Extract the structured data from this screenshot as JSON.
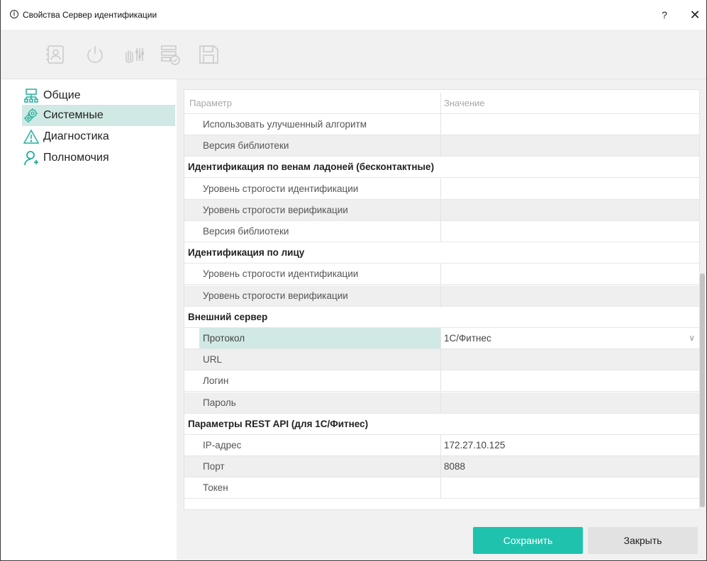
{
  "window": {
    "title": "Свойства Сервер идентификации",
    "help_label": "?",
    "close_label": "✕"
  },
  "toolbar": {
    "icons": [
      "contact-card-icon",
      "power-icon",
      "hand-settings-icon",
      "list-check-icon",
      "save-icon"
    ]
  },
  "sidebar": {
    "items": [
      {
        "label": "Общие",
        "icon": "network-icon",
        "active": false
      },
      {
        "label": "Системные",
        "icon": "gears-icon",
        "active": true
      },
      {
        "label": "Диагностика",
        "icon": "warning-icon",
        "active": false
      },
      {
        "label": "Полномочия",
        "icon": "user-plus-icon",
        "active": false
      }
    ]
  },
  "grid": {
    "header": {
      "param": "Параметр",
      "value": "Значение"
    },
    "rows": [
      {
        "kind": "item",
        "param": "Использовать улучшенный алгоритм",
        "value": ""
      },
      {
        "kind": "item",
        "param": "Версия библиотеки",
        "value": ""
      },
      {
        "kind": "group",
        "param": "Идентификация по венам ладоней (бесконтактные)"
      },
      {
        "kind": "item",
        "param": "Уровень строгости идентификации",
        "value": ""
      },
      {
        "kind": "item",
        "param": "Уровень строгости верификации",
        "value": ""
      },
      {
        "kind": "item",
        "param": "Версия библиотеки",
        "value": ""
      },
      {
        "kind": "group",
        "param": "Идентификация по лицу"
      },
      {
        "kind": "item",
        "param": "Уровень строгости идентификации",
        "value": ""
      },
      {
        "kind": "item",
        "param": "Уровень строгости верификации",
        "value": ""
      },
      {
        "kind": "group",
        "param": "Внешний сервер"
      },
      {
        "kind": "selected",
        "param": "Протокол",
        "value": "1С/Фитнес"
      },
      {
        "kind": "item",
        "param": "URL",
        "value": ""
      },
      {
        "kind": "item",
        "param": "Логин",
        "value": ""
      },
      {
        "kind": "item",
        "param": "Пароль",
        "value": ""
      },
      {
        "kind": "group",
        "param": "Параметры REST API (для 1С/Фитнес)"
      },
      {
        "kind": "item",
        "param": "IP-адрес",
        "value": "172.27.10.125"
      },
      {
        "kind": "item",
        "param": "Порт",
        "value": "8088"
      },
      {
        "kind": "item",
        "param": "Токен",
        "value": ""
      }
    ]
  },
  "footer": {
    "save_label": "Сохранить",
    "close_label": "Закрыть"
  },
  "colors": {
    "accent": "#1fc3ad",
    "selection": "#d0e9e4"
  }
}
